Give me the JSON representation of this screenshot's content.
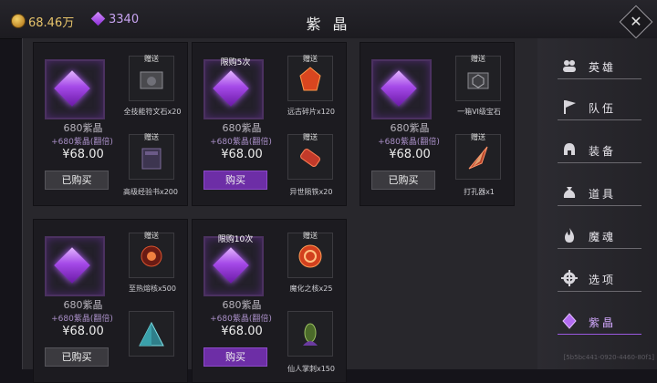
{
  "header": {
    "gold": "68.46万",
    "gems": "3340",
    "title": "紫 晶"
  },
  "cards": [
    {
      "limit": "",
      "name": "680紫晶",
      "bonus": "+680紫晶(翻倍)",
      "price": "¥68.00",
      "button": "已购买",
      "gifts": [
        {
          "tag": "赠送",
          "label": "全技能符文石x20"
        },
        {
          "tag": "赠送",
          "label": "高级经验书x200"
        }
      ]
    },
    {
      "limit": "限购5次",
      "name": "680紫晶",
      "bonus": "+680紫晶(翻倍)",
      "price": "¥68.00",
      "button": "购买",
      "gifts": [
        {
          "tag": "赠送",
          "label": "远古碎片x120"
        },
        {
          "tag": "赠送",
          "label": "异世陨铁x20"
        }
      ]
    },
    {
      "limit": "",
      "name": "680紫晶",
      "bonus": "+680紫晶(翻倍)",
      "price": "¥68.00",
      "button": "已购买",
      "gifts": [
        {
          "tag": "赠送",
          "label": "一箱VI级宝石"
        },
        {
          "tag": "赠送",
          "label": "打孔器x1"
        }
      ]
    },
    {
      "limit": "",
      "name": "680紫晶",
      "bonus": "+680紫晶(翻倍)",
      "price": "¥68.00",
      "button": "已购买",
      "gifts": [
        {
          "tag": "赠送",
          "label": "至热熔核x500"
        },
        {
          "tag": "",
          "label": ""
        }
      ]
    },
    {
      "limit": "限购10次",
      "name": "680紫晶",
      "bonus": "+680紫晶(翻倍)",
      "price": "¥68.00",
      "button": "购买",
      "gifts": [
        {
          "tag": "赠送",
          "label": "魔化之核x25"
        },
        {
          "tag": "",
          "label": "仙人掌刺x150"
        }
      ]
    }
  ],
  "nav": [
    {
      "label": "英雄",
      "icon": "heroes-icon",
      "active": false
    },
    {
      "label": "队伍",
      "icon": "flag-icon",
      "active": false
    },
    {
      "label": "装备",
      "icon": "helmet-icon",
      "active": false
    },
    {
      "label": "道具",
      "icon": "bag-icon",
      "active": false
    },
    {
      "label": "魔魂",
      "icon": "flame-icon",
      "active": false
    },
    {
      "label": "选项",
      "icon": "gear-icon",
      "active": false
    },
    {
      "label": "紫晶",
      "icon": "gem-icon",
      "active": true
    }
  ],
  "footer_id": "[5b5bc441-0920-4460-80f1]"
}
